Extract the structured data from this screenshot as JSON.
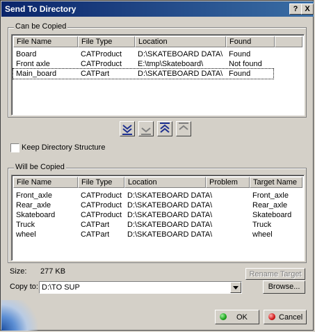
{
  "window": {
    "title": "Send To Directory",
    "help_label": "?",
    "close_label": "X"
  },
  "can_be_copied": {
    "label": "Can be Copied",
    "columns": [
      "File Name",
      "File Type",
      "Location",
      "Found"
    ],
    "rows": [
      [
        "Board",
        "CATProduct",
        "D:\\SKATEBOARD DATA\\",
        "Found"
      ],
      [
        "Front axle",
        "CATProduct",
        "E:\\tmp\\Skateboard\\",
        "Not found"
      ],
      [
        "Main_board",
        "CATPart",
        "D:\\SKATEBOARD DATA\\",
        "Found"
      ]
    ]
  },
  "transfer_buttons": [
    "move-all-down",
    "move-down",
    "move-all-up",
    "move-up"
  ],
  "keep_directory_structure": {
    "label": "Keep Directory Structure",
    "checked": false
  },
  "will_be_copied": {
    "label": "Will be Copied",
    "columns": [
      "File Name",
      "File Type",
      "Location",
      "Problem",
      "Target Name"
    ],
    "rows": [
      [
        "Front_axle",
        "CATProduct",
        "D:\\SKATEBOARD DATA\\",
        "",
        "Front_axle"
      ],
      [
        "Rear_axle",
        "CATProduct",
        "D:\\SKATEBOARD DATA\\",
        "",
        "Rear_axle"
      ],
      [
        "Skateboard",
        "CATProduct",
        "D:\\SKATEBOARD DATA\\",
        "",
        "Skateboard"
      ],
      [
        "Truck",
        "CATPart",
        "D:\\SKATEBOARD DATA\\",
        "",
        "Truck"
      ],
      [
        "wheel",
        "CATPart",
        "D:\\SKATEBOARD DATA\\",
        "",
        "wheel"
      ]
    ]
  },
  "size": {
    "label": "Size:",
    "value": "277 KB"
  },
  "rename_target_label": "Rename Target",
  "copy_to": {
    "label": "Copy to:",
    "value": "D:\\TO SUP"
  },
  "browse_label": "Browse...",
  "ok_label": "OK",
  "cancel_label": "Cancel",
  "colors": {
    "title_start": "#0a246a",
    "title_end": "#3a6ea5",
    "ok_dot": "#1aa21a",
    "cancel_dot": "#d01818",
    "icon_blue": "#1c2f8f"
  }
}
